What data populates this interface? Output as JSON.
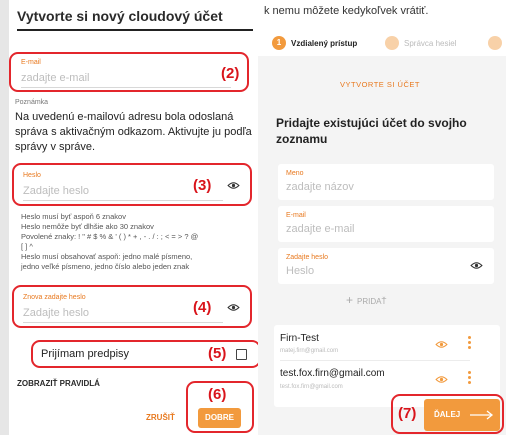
{
  "left": {
    "title": "Vytvorte si nový cloudový účet",
    "email_label": "E-mail",
    "email_placeholder": "zadajte e-mail",
    "note_label": "Poznámka",
    "note_text": "Na uvedenú e-mailovú adresu bola odoslaná správa s aktivačným odkazom. Aktivujte ju podľa správy v správe.",
    "password_label": "Heslo",
    "password_placeholder": "Zadajte heslo",
    "password_rules": [
      "Heslo musí byť aspoň 6 znakov",
      "Heslo nemôže byť dlhšie ako 30 znakov",
      "Povolené znaky: ! \" # $ % & ' ( ) * + , - . / : ; < = > ? @",
      "[ ] ^",
      "Heslo musí obsahovať aspoň: jedno malé písmeno,",
      "jedno veľké písmeno, jedno číslo alebo jeden znak"
    ],
    "repeat_label": "Znova zadajte heslo",
    "repeat_placeholder": "Zadajte heslo",
    "accept_label": "Prijímam predpisy",
    "show_rules": "ZOBRAZIŤ PRAVIDLÁ",
    "cancel": "ZRUŠIŤ",
    "ok": "DOBRE"
  },
  "right": {
    "top_text": "k nemu môžete kedykoľvek vrátiť.",
    "step1_num": "1",
    "step1_label": "Vzdialený prístup",
    "step2_label": "Správca hesiel",
    "create_account": "VYTVORTE SI ÚČET",
    "section_title": "Pridajte existujúci účet do svojho zoznamu",
    "name_label": "Meno",
    "name_placeholder": "zadajte názov",
    "email_label": "E-mail",
    "email_placeholder": "zadajte e-mail",
    "password_label": "Zadajte heslo",
    "password_placeholder": "Heslo",
    "add": "PRIDAŤ",
    "accounts": [
      {
        "name": "Firn-Test",
        "sub": "matej.firn@gmail.com"
      },
      {
        "name": "test.fox.firn@gmail.com",
        "sub": "test.fox.firn@gmail.com"
      }
    ],
    "next": "ĎALEJ"
  },
  "annotations": [
    "(2)",
    "(3)",
    "(4)",
    "(5)",
    "(6)",
    "(7)"
  ],
  "colors": {
    "accent": "#f29a3d",
    "label": "#e8791f",
    "annotation": "#e3262c"
  }
}
